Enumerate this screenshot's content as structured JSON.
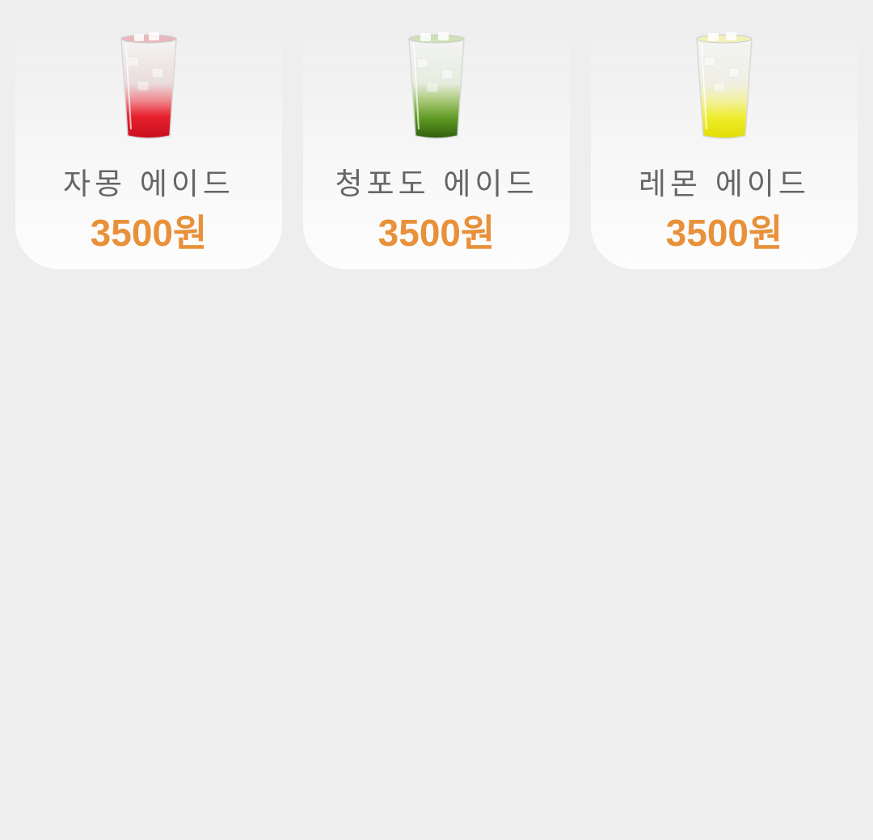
{
  "menu": {
    "items": [
      {
        "name": "자몽 에이드",
        "price": "3500원",
        "icon": "grapefruit-ade-drink-icon",
        "drink_color": "#e8202e"
      },
      {
        "name": "청포도 에이드",
        "price": "3500원",
        "icon": "green-grape-ade-drink-icon",
        "drink_color": "#3f7d14"
      },
      {
        "name": "레몬 에이드",
        "price": "3500원",
        "icon": "lemon-ade-drink-icon",
        "drink_color": "#ecec10"
      }
    ]
  },
  "colors": {
    "background": "#eeeeee",
    "price": "#e8913a",
    "name": "#666666"
  }
}
